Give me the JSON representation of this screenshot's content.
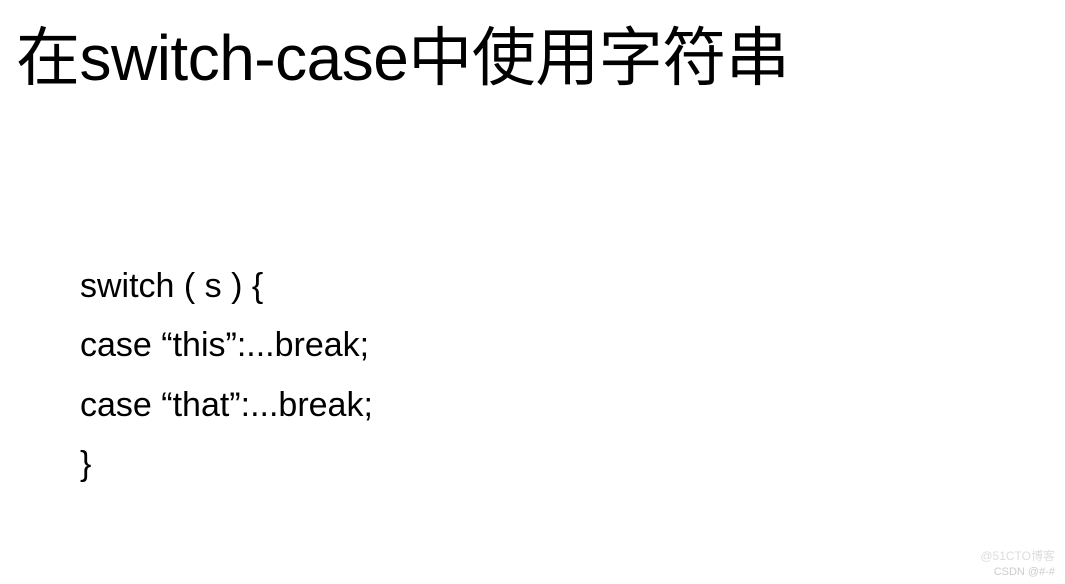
{
  "title": "在switch-case中使用字符串",
  "code": {
    "line1": "switch ( s ) {",
    "line2": "case “this”:...break;",
    "line3": "case “that”:...break;",
    "line4": "}"
  },
  "watermark_top": "@51CTO博客",
  "watermark_bottom": "CSDN @#-#"
}
